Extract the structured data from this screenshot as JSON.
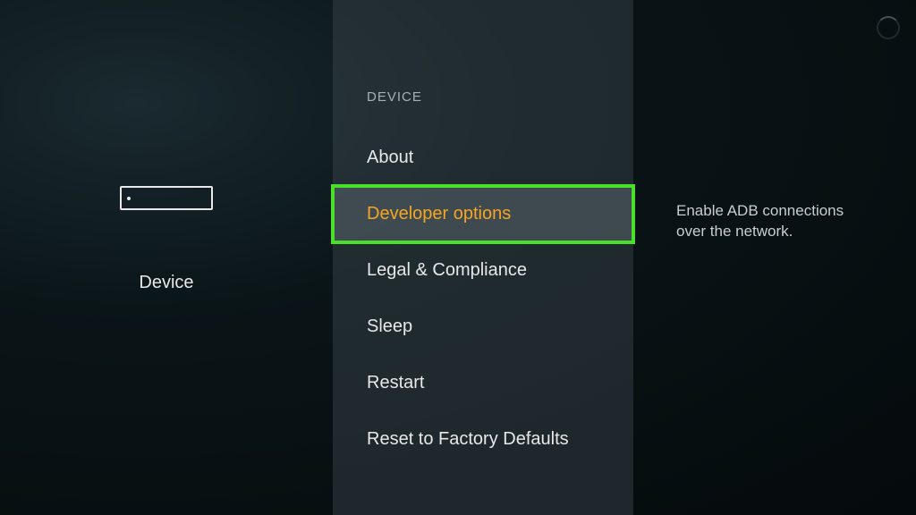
{
  "left": {
    "title": "Device"
  },
  "menu": {
    "header": "DEVICE",
    "items": [
      {
        "label": "About",
        "selected": false
      },
      {
        "label": "Developer options",
        "selected": true
      },
      {
        "label": "Legal & Compliance",
        "selected": false
      },
      {
        "label": "Sleep",
        "selected": false
      },
      {
        "label": "Restart",
        "selected": false
      },
      {
        "label": "Reset to Factory Defaults",
        "selected": false
      }
    ]
  },
  "detail": {
    "description": "Enable ADB connections over the network."
  }
}
